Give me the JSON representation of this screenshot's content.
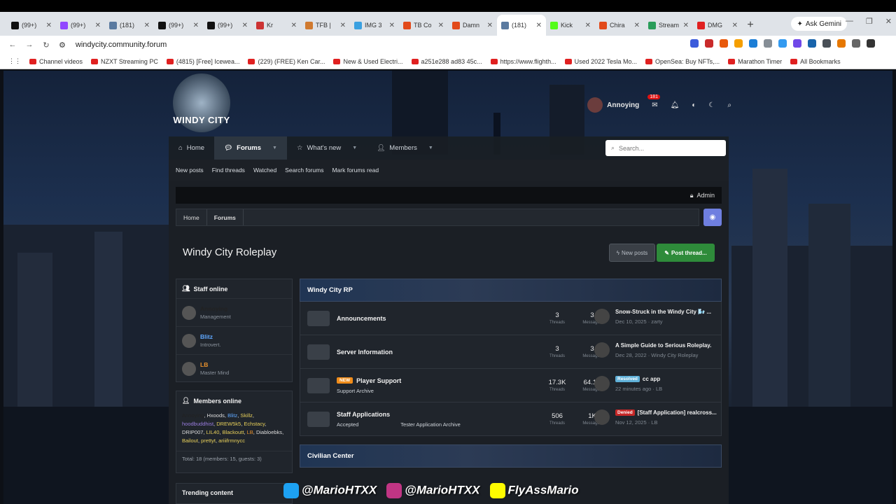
{
  "browser": {
    "tabs": [
      {
        "label": "(99+)",
        "fav": "#111"
      },
      {
        "label": "(99+)",
        "fav": "#9146ff"
      },
      {
        "label": "(181)",
        "fav": "#5a7aa0"
      },
      {
        "label": "(99+)",
        "fav": "#111"
      },
      {
        "label": "(99+)",
        "fav": "#111"
      },
      {
        "label": "Kr",
        "fav": "#c33"
      },
      {
        "label": "TFB |",
        "fav": "#d07a30"
      },
      {
        "label": "IMG 3",
        "fav": "#3aa0e0"
      },
      {
        "label": "TB Co",
        "fav": "#e24a1a"
      },
      {
        "label": "Damn",
        "fav": "#e24a1a"
      },
      {
        "label": "(181)",
        "fav": "#5a7aa0",
        "active": true
      },
      {
        "label": "Kick",
        "fav": "#53fc18"
      },
      {
        "label": "Chira",
        "fav": "#e24a1a"
      },
      {
        "label": "Stream",
        "fav": "#2a9d5a"
      },
      {
        "label": "DMG",
        "fav": "#e02020"
      }
    ],
    "ask_gemini": "Ask Gemini",
    "url": "windycity.community.forum",
    "bookmarks": [
      "Channel videos",
      "NZXT Streaming PC",
      "(4815) [Free] Icewea...",
      "(229) (FREE) Ken Car...",
      "New & Used Electri...",
      "a251e288 ad83 45c...",
      "https://www.flighth...",
      "Used 2022 Tesla Mo...",
      "OpenSea: Buy NFTs,...",
      "Marathon Timer",
      "All Bookmarks"
    ]
  },
  "site": {
    "logo_text": "WINDY CITY",
    "username": "Annoying",
    "msg_badge": "181",
    "nav": {
      "home": "Home",
      "forums": "Forums",
      "whats_new": "What's new",
      "members": "Members"
    },
    "search_placeholder": "Search...",
    "subnav": [
      "New posts",
      "Find threads",
      "Watched",
      "Search forums",
      "Mark forums read"
    ],
    "admin": "Admin",
    "breadcrumb": [
      "Home",
      "Forums"
    ],
    "page_title": "Windy City Roleplay",
    "new_posts_btn": "New posts",
    "post_thread_btn": "Post thread...",
    "staff_online": {
      "title": "Staff online",
      "staff": [
        {
          "name": "Annoying",
          "role": "Management",
          "color": "#222"
        },
        {
          "name": "Blitz",
          "role": "Introvert.",
          "color": "#5fa8ff"
        },
        {
          "name": "LB",
          "role": "Master Mind",
          "color": "#e8912d"
        }
      ]
    },
    "members_online": {
      "title": "Members online",
      "members": [
        {
          "name": "Annoying",
          "color": "#222"
        },
        {
          "name": "Hxoods",
          "color": "#ddd"
        },
        {
          "name": "Blitz",
          "color": "#5fa8ff"
        },
        {
          "name": "Skillz",
          "color": "#e8d05a"
        },
        {
          "name": "hoodbuddhist",
          "color": "#9a7de0"
        },
        {
          "name": "DREW5k5",
          "color": "#e8d05a"
        },
        {
          "name": "Echstacy",
          "color": "#e8d05a"
        },
        {
          "name": "DRIP007",
          "color": "#ddd"
        },
        {
          "name": "LIL40",
          "color": "#e8d05a"
        },
        {
          "name": "Blackoutt",
          "color": "#e8d05a"
        },
        {
          "name": "LB",
          "color": "#e8912d"
        },
        {
          "name": "Diabloebks",
          "color": "#ddd"
        },
        {
          "name": "Bailout",
          "color": "#e8d05a"
        },
        {
          "name": "prettyt",
          "color": "#e8d05a"
        },
        {
          "name": "ariiifrmnycc",
          "color": "#e8d05a"
        }
      ],
      "total": "Total: 18 (members: 15, guests: 3)"
    },
    "trending": "Trending content",
    "categories": [
      {
        "title": "Windy City RP",
        "nodes": [
          {
            "title": "Announcements",
            "sub": [],
            "threads": "3",
            "messages": "3",
            "last_title": "Snow-Struck in the Windy City 🌬️ ...",
            "last_meta": "Dec 10, 2025 · zarty",
            "tag": "",
            "tag_color": ""
          },
          {
            "title": "Server Information",
            "sub": [],
            "threads": "3",
            "messages": "3",
            "last_title": "A Simple Guide to Serious Roleplay.",
            "last_meta": "Dec 28, 2022 · Windy City Roleplay",
            "tag": "",
            "tag_color": ""
          },
          {
            "title": "Player Support",
            "new": "NEW",
            "sub": [
              "Support Archive"
            ],
            "threads": "17.3K",
            "messages": "64.1K",
            "last_title": "cc app",
            "last_meta": "22 minutes ago · LB",
            "tag": "Resolved",
            "tag_color": "#5fb0d8"
          },
          {
            "title": "Staff Applications",
            "sub": [
              "Accepted",
              "Tester Application Archive"
            ],
            "threads": "506",
            "messages": "1K",
            "last_title": "[Staff Application] realcross...",
            "last_meta": "Nov 12, 2025 · LB",
            "tag": "Denied",
            "tag_color": "#c62828"
          }
        ]
      },
      {
        "title": "Civilian Center",
        "nodes": []
      }
    ],
    "stat_labels": {
      "threads": "Threads",
      "messages": "Messages"
    }
  },
  "overlay": {
    "twitter": "@MarioHTXX",
    "instagram": "@MarioHTXX",
    "snapchat": "FlyAssMario"
  }
}
